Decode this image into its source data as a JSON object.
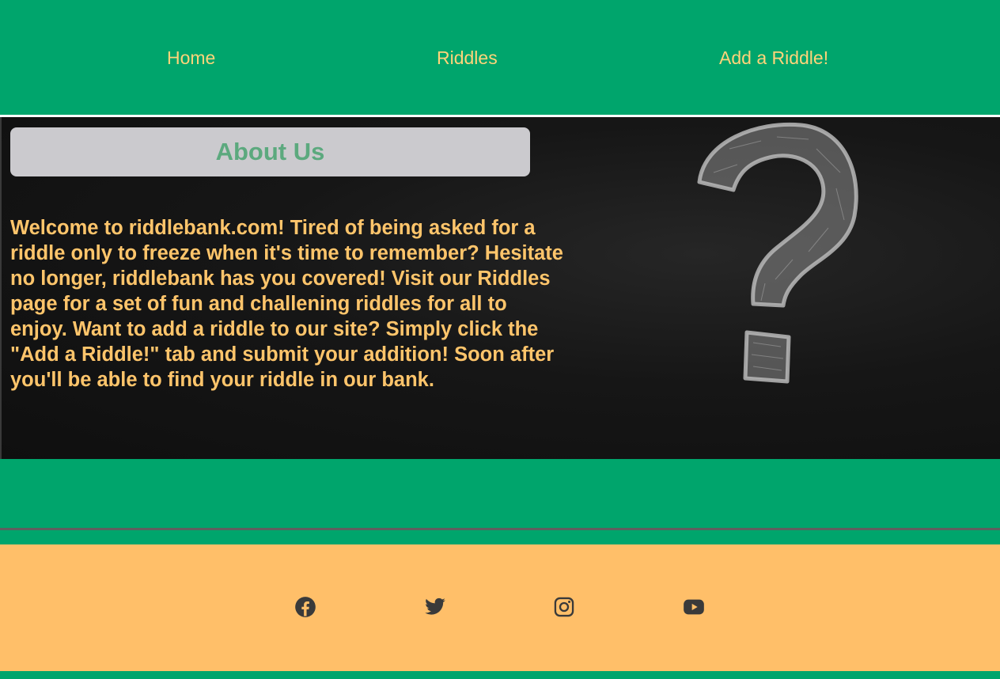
{
  "nav": {
    "items": [
      {
        "label": "Home"
      },
      {
        "label": "Riddles"
      },
      {
        "label": "Add a Riddle!"
      }
    ]
  },
  "hero": {
    "title": "About Us",
    "body": "Welcome to riddlebank.com! Tired of being asked for a riddle only to freeze when it's time to remember? Hesitate no longer, riddlebank has you covered! Visit our Riddles page for a set of fun and challening riddles for all to enjoy. Want to add a riddle to our site? Simply click the \"Add a Riddle!\" tab and submit your addition! Soon after you'll be able to find your riddle in our bank.",
    "image": "chalk-question-mark"
  },
  "footer": {
    "social": [
      {
        "icon": "facebook-icon"
      },
      {
        "icon": "twitter-icon"
      },
      {
        "icon": "instagram-icon"
      },
      {
        "icon": "youtube-icon"
      }
    ]
  },
  "colors": {
    "page_bg": "#00a56c",
    "nav_text": "#ffd47a",
    "about_title": "#5ca97e",
    "about_box": "#cbcace",
    "body_text": "#ffc56b",
    "footer_bg": "#ffbf69",
    "icon": "#3a3a3a"
  }
}
